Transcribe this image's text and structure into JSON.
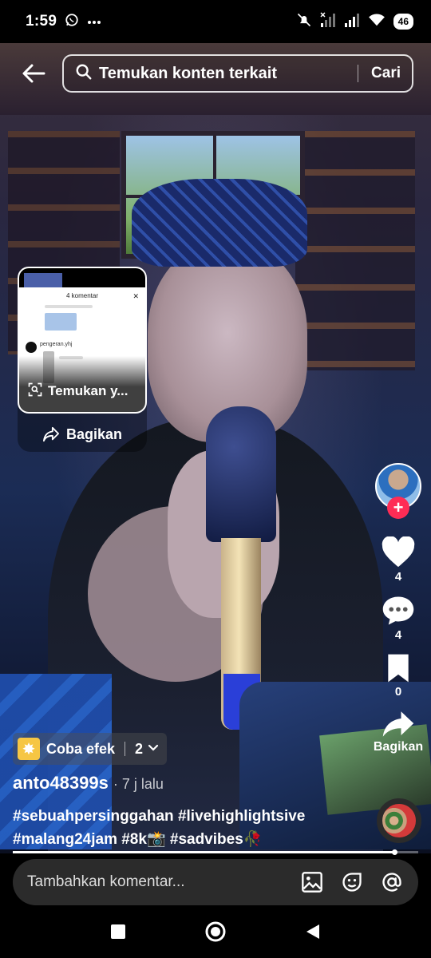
{
  "status_bar": {
    "time": "1:59",
    "battery": "46",
    "icons": [
      "whatsapp-icon",
      "more-dots-icon",
      "mute-icon",
      "signal-icon",
      "signal-icon",
      "wifi-icon",
      "battery-icon"
    ]
  },
  "search": {
    "placeholder": "Temukan konten terkait",
    "button_label": "Cari"
  },
  "share_card": {
    "thumbnail_header": "4 komentar",
    "thumbnail_user": "pengeran.yhj",
    "overlay_text": "Temukan y...",
    "share_label": "Bagikan"
  },
  "rail": {
    "likes": "4",
    "comments": "4",
    "saves": "0",
    "share_label": "Bagikan"
  },
  "effect": {
    "label": "Coba efek",
    "count": "2"
  },
  "author": {
    "username": "anto48399s",
    "time": "· 7 j lalu"
  },
  "caption": {
    "line1": "#sebuahpersinggahan #livehighlightsive",
    "line2": "#malang24jam #8k📸 #sadvibes🥀"
  },
  "progress": {
    "played_fraction": 0.94
  },
  "comment_bar": {
    "placeholder": "Tambahkan komentar..."
  },
  "colors": {
    "accent": "#fe2c55",
    "effect_icon": "#f6c644"
  }
}
